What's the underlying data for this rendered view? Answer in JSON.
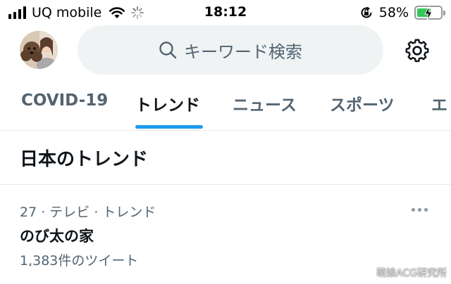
{
  "status_bar": {
    "carrier": "UQ mobile",
    "time": "18:12",
    "battery_percent": "58%",
    "battery_level": 0.58,
    "icons": [
      "signal-icon",
      "wifi-icon",
      "loading-spinner-icon",
      "orientation-lock-icon",
      "battery-charging-icon"
    ]
  },
  "header": {
    "search_placeholder": "キーワード検索",
    "icons": [
      "avatar",
      "search-icon",
      "gear-icon"
    ]
  },
  "tabs": [
    {
      "label": "COVID-19",
      "active": false
    },
    {
      "label": "トレンド",
      "active": true
    },
    {
      "label": "ニュース",
      "active": false
    },
    {
      "label": "スポーツ",
      "active": false
    },
    {
      "label": "エ",
      "active": false
    }
  ],
  "section": {
    "title": "日本のトレンド"
  },
  "trends": [
    {
      "meta": "27 · テレビ · トレンド",
      "name": "のび太の家",
      "count": "1,383件のツイート"
    }
  ],
  "watermark": "萌娘ACG研究所",
  "colors": {
    "accent": "#1d9bf0",
    "text_primary": "#0f1419",
    "text_secondary": "#536471",
    "battery": "#34c759"
  }
}
